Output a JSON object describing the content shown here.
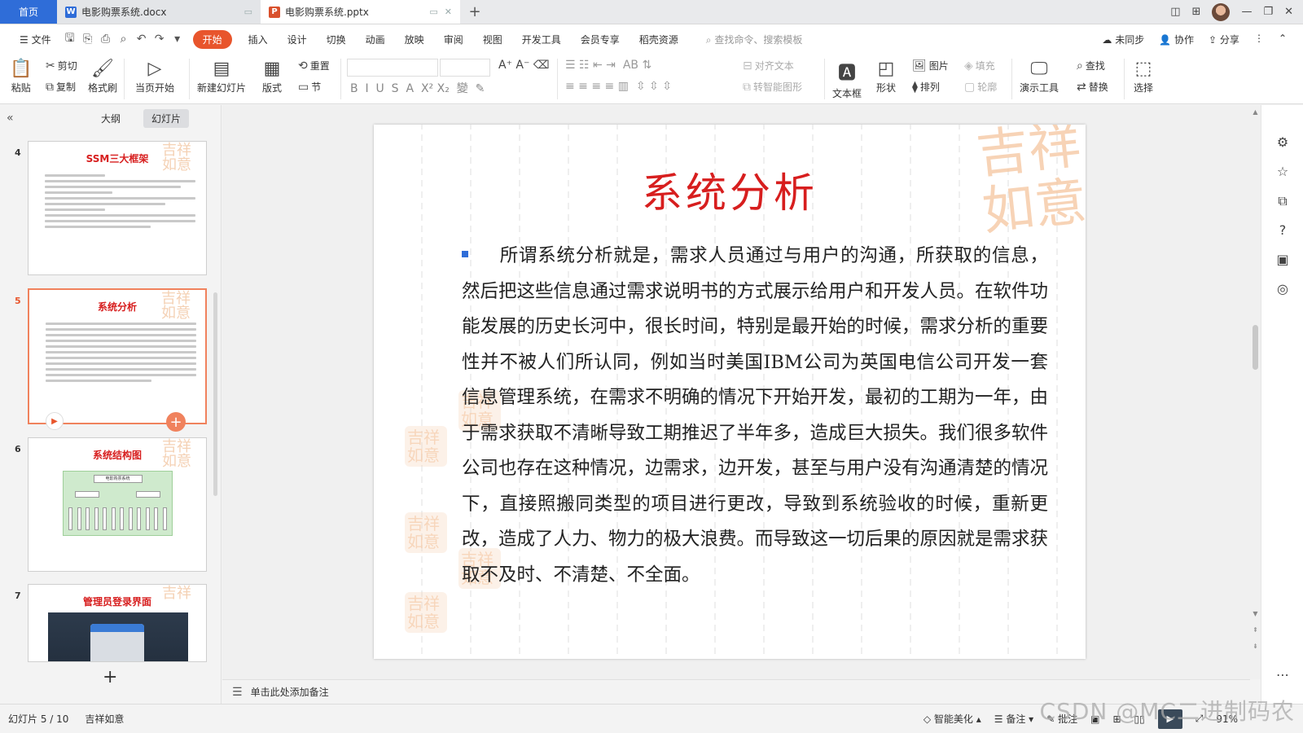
{
  "tabs": {
    "home": "首页",
    "docx": "电影购票系统.docx",
    "pptx": "电影购票系统.pptx"
  },
  "menu": {
    "file": "文件",
    "items": [
      "开始",
      "插入",
      "设计",
      "切换",
      "动画",
      "放映",
      "审阅",
      "视图",
      "开发工具",
      "会员专享",
      "稻壳资源"
    ],
    "search": "查找命令、搜索模板",
    "unsync": "未同步",
    "collab": "协作",
    "share": "分享"
  },
  "ribbon": {
    "paste": "粘贴",
    "cut": "剪切",
    "copy": "复制",
    "format_painter": "格式刷",
    "from_current": "当页开始",
    "new_slide": "新建幻灯片",
    "layout": "版式",
    "reset": "重置",
    "section": "节",
    "align_text": "对齐文本",
    "smart_art": "转智能图形",
    "textbox": "文本框",
    "shape": "形状",
    "picture": "图片",
    "arrange": "排列",
    "fill": "填充",
    "outline": "轮廓",
    "presenter": "演示工具",
    "find": "查找",
    "replace": "替换",
    "select": "选择"
  },
  "panel": {
    "outline_tab": "大纲",
    "slides_tab": "幻灯片",
    "thumbnails": [
      {
        "num": "4",
        "title": "SSM三大框架"
      },
      {
        "num": "5",
        "title": "系统分析"
      },
      {
        "num": "6",
        "title": "系统结构图",
        "chart_title": "电影购票系统"
      },
      {
        "num": "7",
        "title": "管理员登录界面"
      }
    ]
  },
  "slide": {
    "title": "系统分析",
    "body": "所谓系统分析就是，需求人员通过与用户的沟通，所获取的信息，然后把这些信息通过需求说明书的方式展示给用户和开发人员。在软件功能发展的历史长河中，很长时间，特别是最开始的时候，需求分析的重要性并不被人们所认同，例如当时美国IBM公司为英国电信公司开发一套信息管理系统，在需求不明确的情况下开始开发，最初的工期为一年，由于需求获取不清晰导致工期推迟了半年多，造成巨大损失。我们很多软件公司也存在这种情况，边需求，边开发，甚至与用户没有沟通清楚的情况下，直接照搬同类型的项目进行更改，导致到系统验收的时候，重新更改，造成了人力、物力的极大浪费。而导致这一切后果的原因就是需求获取不及时、不清楚、不全面。",
    "seal_text": "吉祥如意"
  },
  "notes_placeholder": "单击此处添加备注",
  "status": {
    "slide_counter": "幻灯片 5 / 10",
    "theme": "吉祥如意",
    "smart_beautify": "智能美化",
    "notes": "备注",
    "comments": "批注",
    "zoom": "91%"
  },
  "watermark": "CSDN @MC二进制码农",
  "colors": {
    "accent": "#e8552c",
    "title_red": "#d71e1e",
    "home_blue": "#2f6dd8"
  }
}
